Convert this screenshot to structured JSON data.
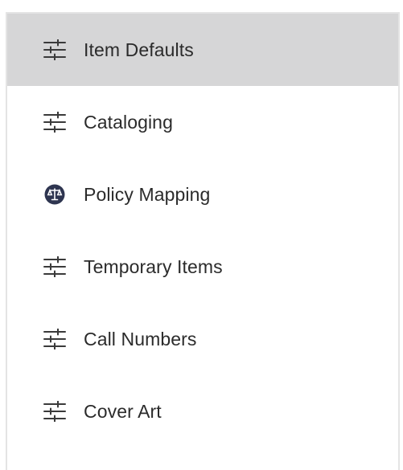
{
  "menu": {
    "items": [
      {
        "label": "Item Defaults",
        "icon": "sliders-icon",
        "active": true
      },
      {
        "label": "Cataloging",
        "icon": "sliders-icon",
        "active": false
      },
      {
        "label": "Policy Mapping",
        "icon": "scales-icon",
        "active": false
      },
      {
        "label": "Temporary Items",
        "icon": "sliders-icon",
        "active": false
      },
      {
        "label": "Call Numbers",
        "icon": "sliders-icon",
        "active": false
      },
      {
        "label": "Cover Art",
        "icon": "sliders-icon",
        "active": false
      }
    ]
  },
  "colors": {
    "active_background": "#d6d6d7",
    "text": "#2b2b2b",
    "icon": "#3a3a3a",
    "policy_icon_background": "#2e3550"
  }
}
